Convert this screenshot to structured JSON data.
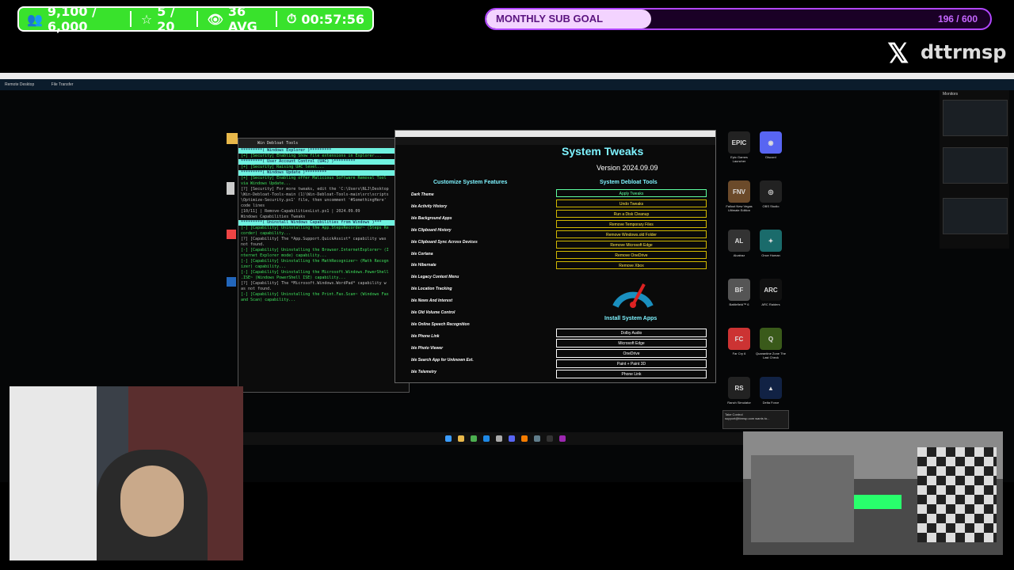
{
  "stats": {
    "followers": "9,100 / 6,000",
    "rating": "5 / 20",
    "viewers": "36 AVG",
    "timer": "00:57:56"
  },
  "sub_goal": {
    "label": "MONTHLY SUB GOAL",
    "count": "196 / 600",
    "progress": 0.327
  },
  "handle": "dttrmsp",
  "remote_desktop": {
    "tab_remote": "Remote Desktop",
    "tab_file": "File Transfer",
    "monitors_label": "Monitors"
  },
  "terminal": {
    "tab": "Win Debloat Tools",
    "lines": [
      {
        "cls": "hl",
        "text": "*********( Windows Explorer )*********"
      },
      {
        "cls": "g",
        "text": "[+] [Security] Enabling Show file extensions in Explorer..."
      },
      {
        "cls": "hl",
        "text": "*********( User Account Control (UAC) )*********"
      },
      {
        "cls": "g",
        "text": "[+] [Security] Raising UAC level..."
      },
      {
        "cls": "hl",
        "text": "*********( Windows Update )*********"
      },
      {
        "cls": "g",
        "text": "[+] [Security] Enabling offer Malicious Software Removal Tool"
      },
      {
        "cls": "g",
        "text": "via Windows Update..."
      },
      {
        "cls": "dim",
        "text": "[?] [Security] For more tweaks, edit the 'C:\\Users\\NLJ\\Desktop"
      },
      {
        "cls": "dim",
        "text": "\\Win-Debloat-Tools-main (1)\\Win-Debloat-Tools-main\\src\\scripts"
      },
      {
        "cls": "dim",
        "text": "\\Optimize-Security.ps1' file, then uncomment '#SomethingHere'"
      },
      {
        "cls": "dim",
        "text": "code lines"
      },
      {
        "cls": "dim",
        "text": ""
      },
      {
        "cls": "dim",
        "text": "  [10/11] | Remove-CapabilitiesList.ps1 | 2024.09.09"
      },
      {
        "cls": "dim",
        "text": ""
      },
      {
        "cls": "dim",
        "text": "  Windows Capabilities Tweaks"
      },
      {
        "cls": "dim",
        "text": ""
      },
      {
        "cls": "hl",
        "text": "*********( Uninstall Windows Capabilities from Windows )***"
      },
      {
        "cls": "dim",
        "text": ""
      },
      {
        "cls": "g",
        "text": "[-] [Capability] Uninstalling the App.StepsRecorder~ (Steps Re"
      },
      {
        "cls": "g",
        "text": "corder) capability..."
      },
      {
        "cls": "dim",
        "text": "[?] [Capability] The *App.Support.QuickAssist* capability was"
      },
      {
        "cls": "dim",
        "text": "not found."
      },
      {
        "cls": "g",
        "text": "[-] [Capability] Uninstalling the Browser.InternetExplorer~ (I"
      },
      {
        "cls": "g",
        "text": "nternet Explorer mode) capability..."
      },
      {
        "cls": "g",
        "text": "[-] [Capability] Uninstalling the MathRecognizer~ (Math Recogn"
      },
      {
        "cls": "g",
        "text": "izer) capability..."
      },
      {
        "cls": "g",
        "text": "[-] [Capability] Uninstalling the Microsoft.Windows.PowerShell"
      },
      {
        "cls": "g",
        "text": ".ISE~ (Windows PowerShell ISE) capability..."
      },
      {
        "cls": "dim",
        "text": "[?] [Capability] The *Microsoft.Windows.WordPad* capability w"
      },
      {
        "cls": "dim",
        "text": "as not found."
      },
      {
        "cls": "g",
        "text": "[-] [Capability] Uninstalling the Print.Fax.Scan~ (Windows Fax"
      },
      {
        "cls": "g",
        "text": "and Scan) capability..."
      }
    ]
  },
  "tweaks": {
    "title": "System Tweaks",
    "version": "Version 2024.09.09",
    "customize_heading": "Customize System Features",
    "debloat_heading": "System Debloat Tools",
    "install_heading": "Install System Apps",
    "features": [
      "Dark Theme",
      "ble Activity History",
      "ble Background Apps",
      "ble Clipboard History",
      "ble Clipboard Sync Across Devices",
      "ble Cortana",
      "ble Hibernate",
      "ble Legacy Context Menu",
      "ble Location Tracking",
      "ble News And Interest",
      "ble Old Volume Control",
      "ble Online Speech Recognition",
      "ble Phone Link",
      "ble Photo Viewer",
      "ble Search App for Unknown Ext.",
      "ble Telemetry"
    ],
    "debloat_buttons": [
      "Apply Tweaks",
      "Undo Tweaks",
      "Run a Disk Cleanup",
      "Remove Temporary Files",
      "Remove Windows.old Folder",
      "Remove Microsoft Edge",
      "Remove OneDrive",
      "Remove Xbox"
    ],
    "install_buttons": [
      "Dolby Audio",
      "Microsoft Edge",
      "OneDrive",
      "Paint + Paint 3D",
      "Phone Link"
    ]
  },
  "desktop_icons": [
    {
      "label": "Epic Games Launcher",
      "glyph": "EPIC",
      "color": "#222"
    },
    {
      "label": "Discord",
      "glyph": "◉",
      "color": "#5865f2"
    },
    {
      "label": "Fallout New Vegas Ultimate Edition",
      "glyph": "FNV",
      "color": "#6b4a2a"
    },
    {
      "label": "OBS Studio",
      "glyph": "◎",
      "color": "#222"
    },
    {
      "label": "Alcatraz",
      "glyph": "AL",
      "color": "#333"
    },
    {
      "label": "Once Human",
      "glyph": "✦",
      "color": "#1a6b6b"
    },
    {
      "label": "Battlefield™ 6",
      "glyph": "BF",
      "color": "#555"
    },
    {
      "label": "ARC Raiders",
      "glyph": "ARC",
      "color": "#111"
    },
    {
      "label": "Far Cry 6",
      "glyph": "FC",
      "color": "#c33"
    },
    {
      "label": "Quarantine Zone The Last Check",
      "glyph": "Q",
      "color": "#3a5a1a"
    },
    {
      "label": "Ranch Simulator",
      "glyph": "RS",
      "color": "#222"
    },
    {
      "label": "Delta Force",
      "glyph": "▲",
      "color": "#124"
    }
  ],
  "toast": {
    "title": "Take Control",
    "body": "support@ttrmsp.com wants to..."
  }
}
